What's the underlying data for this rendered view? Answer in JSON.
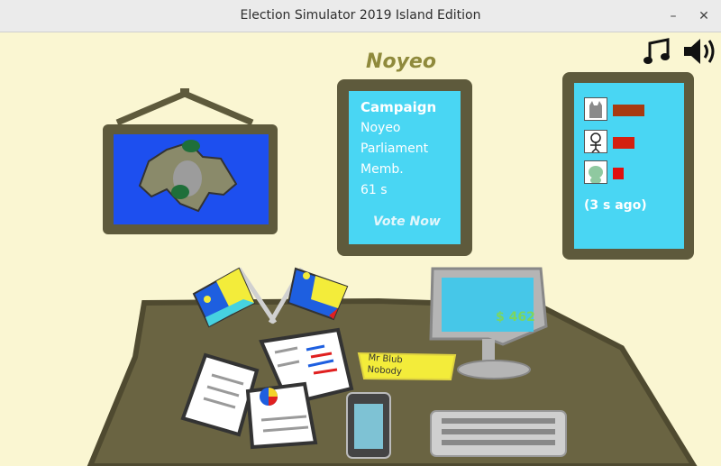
{
  "window": {
    "title": "Election Simulator 2019 Island Edition",
    "minimize": "–",
    "close": "✕"
  },
  "country": "Noyeo",
  "campaign": {
    "heading": "Campaign",
    "lines": [
      "Noyeo",
      "Parliament",
      "Memb.",
      "61 s"
    ],
    "vote_label": "Vote Now"
  },
  "polls": {
    "rows": [
      {
        "candidate_icon": "cat-avatar-icon",
        "bar_color": "#a83a10",
        "share": 1.0
      },
      {
        "candidate_icon": "stick-figure-avatar-icon",
        "bar_color": "#d42010",
        "share": 0.69
      },
      {
        "candidate_icon": "dog-avatar-icon",
        "bar_color": "#e01010",
        "share": 0.34
      }
    ],
    "updated": "(3 s ago)"
  },
  "money": "$ 462",
  "name_card": {
    "line1": "Mr Blub",
    "line2": "Nobody"
  },
  "icons": {
    "music": "music-note-icon",
    "sound": "speaker-icon"
  },
  "colors": {
    "wall": "#faf6d2",
    "screen": "#49d6f3",
    "frame": "#5e5a3c",
    "desk": "#6a6442",
    "map_sea": "#1d4fef"
  }
}
